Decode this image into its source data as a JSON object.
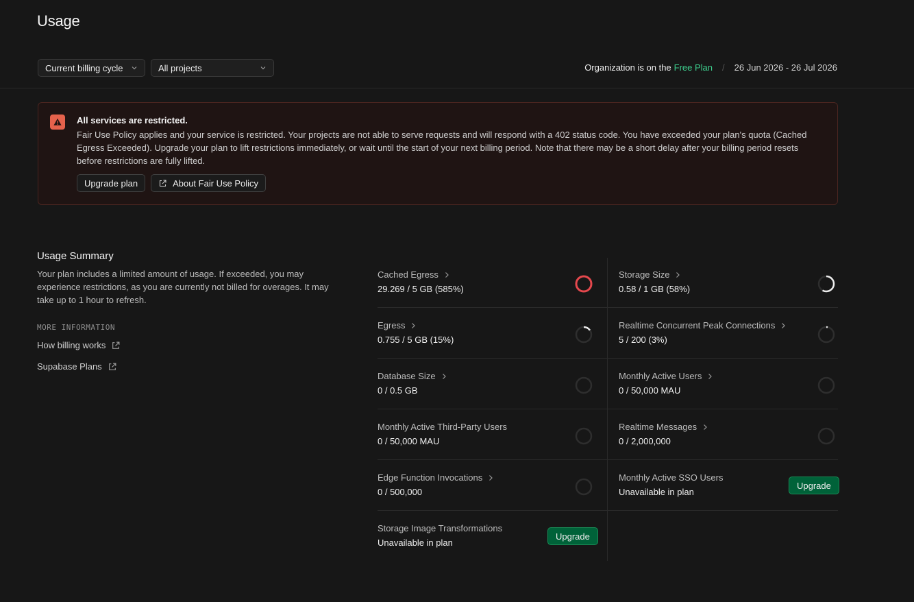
{
  "page_title": "Usage",
  "filters": {
    "billing_cycle": "Current billing cycle",
    "projects": "All projects"
  },
  "plan": {
    "org_text": "Organization is on the",
    "plan_name": "Free Plan",
    "separator": "/",
    "dates": "26 Jun 2026 - 26 Jul 2026"
  },
  "alert": {
    "title": "All services are restricted.",
    "body": "Fair Use Policy applies and your service is restricted. Your projects are not able to serve requests and will respond with a 402 status code. You have exceeded your plan's quota (Cached Egress Exceeded). Upgrade your plan to lift restrictions immediately, or wait until the start of your next billing period. Note that there may be a short delay after your billing period resets before restrictions are fully lifted.",
    "upgrade_label": "Upgrade plan",
    "policy_label": "About Fair Use Policy"
  },
  "summary": {
    "title": "Usage Summary",
    "description": "Your plan includes a limited amount of usage. If exceeded, you may experience restrictions, as you are currently not billed for overages. It may take up to 1 hour to refresh.",
    "more_info_heading": "MORE INFORMATION",
    "links": [
      "How billing works",
      "Supabase Plans"
    ]
  },
  "metrics": [
    {
      "label": "Cached Egress",
      "value": "29.269 / 5 GB (585%)",
      "percent": 585,
      "has_chevron": true
    },
    {
      "label": "Storage Size",
      "value": "0.58 / 1 GB (58%)",
      "percent": 58,
      "has_chevron": true
    },
    {
      "label": "Egress",
      "value": "0.755 / 5 GB (15%)",
      "percent": 15,
      "has_chevron": true
    },
    {
      "label": "Realtime Concurrent Peak Connections",
      "value": "5 / 200 (3%)",
      "percent": 3,
      "has_chevron": true
    },
    {
      "label": "Database Size",
      "value": "0 / 0.5 GB",
      "percent": 0,
      "has_chevron": true
    },
    {
      "label": "Monthly Active Users",
      "value": "0 / 50,000 MAU",
      "percent": 0,
      "has_chevron": true
    },
    {
      "label": "Monthly Active Third-Party Users",
      "value": "0 / 50,000 MAU",
      "percent": 0,
      "has_chevron": false
    },
    {
      "label": "Realtime Messages",
      "value": "0 / 2,000,000",
      "percent": 0,
      "has_chevron": true
    },
    {
      "label": "Edge Function Invocations",
      "value": "0 / 500,000",
      "percent": 0,
      "has_chevron": true
    },
    {
      "label": "Monthly Active SSO Users",
      "value": "Unavailable in plan",
      "upgrade": "Upgrade",
      "has_chevron": false
    },
    {
      "label": "Storage Image Transformations",
      "value": "Unavailable in plan",
      "upgrade": "Upgrade",
      "has_chevron": false
    }
  ],
  "colors": {
    "accent": "#3ecf8e",
    "danger": "#e5484d",
    "ring_track": "#2e2e2e",
    "ring_fill": "#ededed",
    "upgrade_bg": "#006239"
  }
}
